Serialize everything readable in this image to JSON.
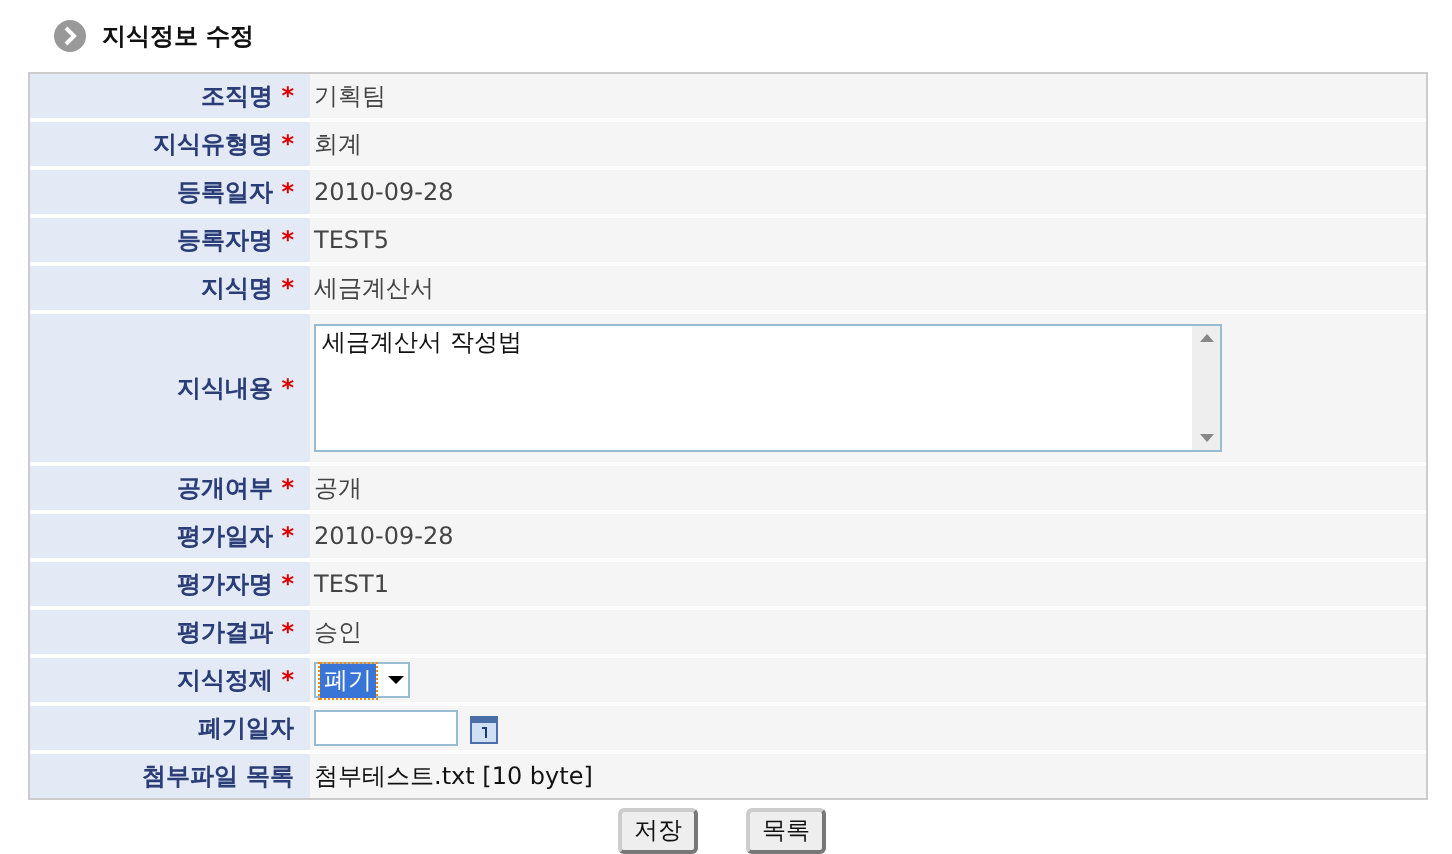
{
  "page_title": "지식정보 수정",
  "required_mark": "*",
  "rows": [
    {
      "label": "조직명",
      "required": true,
      "kind": "text",
      "value": "기획팀"
    },
    {
      "label": "지식유형명",
      "required": true,
      "kind": "text",
      "value": "회계"
    },
    {
      "label": "등록일자",
      "required": true,
      "kind": "text",
      "value": "2010-09-28"
    },
    {
      "label": "등록자명",
      "required": true,
      "kind": "text",
      "value": "TEST5"
    },
    {
      "label": "지식명",
      "required": true,
      "kind": "text",
      "value": "세금계산서"
    },
    {
      "label": "지식내용",
      "required": true,
      "kind": "textarea",
      "value": "세금계산서 작성법"
    },
    {
      "label": "공개여부",
      "required": true,
      "kind": "text",
      "value": "공개"
    },
    {
      "label": "평가일자",
      "required": true,
      "kind": "text",
      "value": "2010-09-28"
    },
    {
      "label": "평가자명",
      "required": true,
      "kind": "text",
      "value": "TEST1"
    },
    {
      "label": "평가결과",
      "required": true,
      "kind": "text",
      "value": "승인"
    },
    {
      "label": "지식정제",
      "required": true,
      "kind": "select",
      "value": "폐기"
    },
    {
      "label": "폐기일자",
      "required": false,
      "kind": "date"
    },
    {
      "label": "첨부파일 목록",
      "required": false,
      "kind": "file",
      "value": "첨부테스트.txt [10 byte]"
    }
  ],
  "buttons": [
    "저장",
    "목록"
  ]
}
